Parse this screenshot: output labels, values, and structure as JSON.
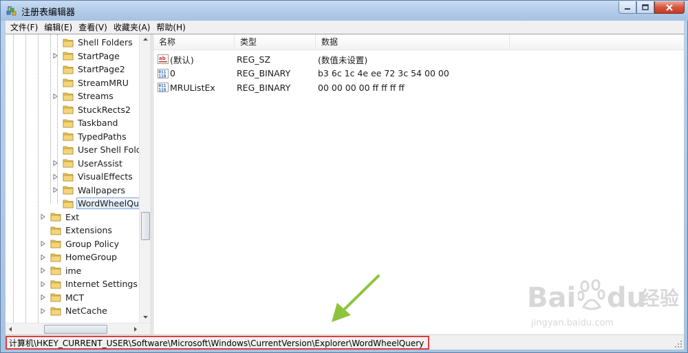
{
  "window": {
    "title": "注册表编辑器",
    "menu": [
      "文件(F)",
      "编辑(E)",
      "查看(V)",
      "收藏夹(A)",
      "帮助(H)"
    ]
  },
  "tree": {
    "items": [
      {
        "label": "Shell Folders",
        "level": 2,
        "expandable": false
      },
      {
        "label": "StartPage",
        "level": 2,
        "expandable": true
      },
      {
        "label": "StartPage2",
        "level": 2,
        "expandable": false
      },
      {
        "label": "StreamMRU",
        "level": 2,
        "expandable": false
      },
      {
        "label": "Streams",
        "level": 2,
        "expandable": true
      },
      {
        "label": "StuckRects2",
        "level": 2,
        "expandable": false
      },
      {
        "label": "Taskband",
        "level": 2,
        "expandable": false
      },
      {
        "label": "TypedPaths",
        "level": 2,
        "expandable": false
      },
      {
        "label": "User Shell Folde",
        "level": 2,
        "expandable": false
      },
      {
        "label": "UserAssist",
        "level": 2,
        "expandable": true
      },
      {
        "label": "VisualEffects",
        "level": 2,
        "expandable": true
      },
      {
        "label": "Wallpapers",
        "level": 2,
        "expandable": true
      },
      {
        "label": "WordWheelQue",
        "level": 2,
        "expandable": false,
        "selected": true
      },
      {
        "label": "Ext",
        "level": 1,
        "expandable": true
      },
      {
        "label": "Extensions",
        "level": 1,
        "expandable": false
      },
      {
        "label": "Group Policy",
        "level": 1,
        "expandable": true
      },
      {
        "label": "HomeGroup",
        "level": 1,
        "expandable": true
      },
      {
        "label": "ime",
        "level": 1,
        "expandable": true
      },
      {
        "label": "Internet Settings",
        "level": 1,
        "expandable": true
      },
      {
        "label": "MCT",
        "level": 1,
        "expandable": true
      },
      {
        "label": "NetCache",
        "level": 1,
        "expandable": true
      }
    ]
  },
  "list": {
    "columns": [
      "名称",
      "类型",
      "数据"
    ],
    "rows": [
      {
        "icon": "string-value-icon",
        "name": "(默认)",
        "type": "REG_SZ",
        "data": "(数值未设置)"
      },
      {
        "icon": "binary-value-icon",
        "name": "0",
        "type": "REG_BINARY",
        "data": "b3 6c 1c 4e ee 72 3c 54 00 00"
      },
      {
        "icon": "binary-value-icon",
        "name": "MRUListEx",
        "type": "REG_BINARY",
        "data": "00 00 00 00 ff ff ff ff"
      }
    ]
  },
  "status": {
    "path": "计算机\\HKEY_CURRENT_USER\\Software\\Microsoft\\Windows\\CurrentVersion\\Explorer\\WordWheelQuery"
  },
  "watermark": {
    "brand": "Bai",
    "brand2": "du",
    "cn": "经验",
    "url": "jingyan.baidu.com"
  },
  "colors": {
    "highlight_border": "#e23b3b",
    "arrow": "#8cc43c",
    "folder": "#e8c35a"
  }
}
